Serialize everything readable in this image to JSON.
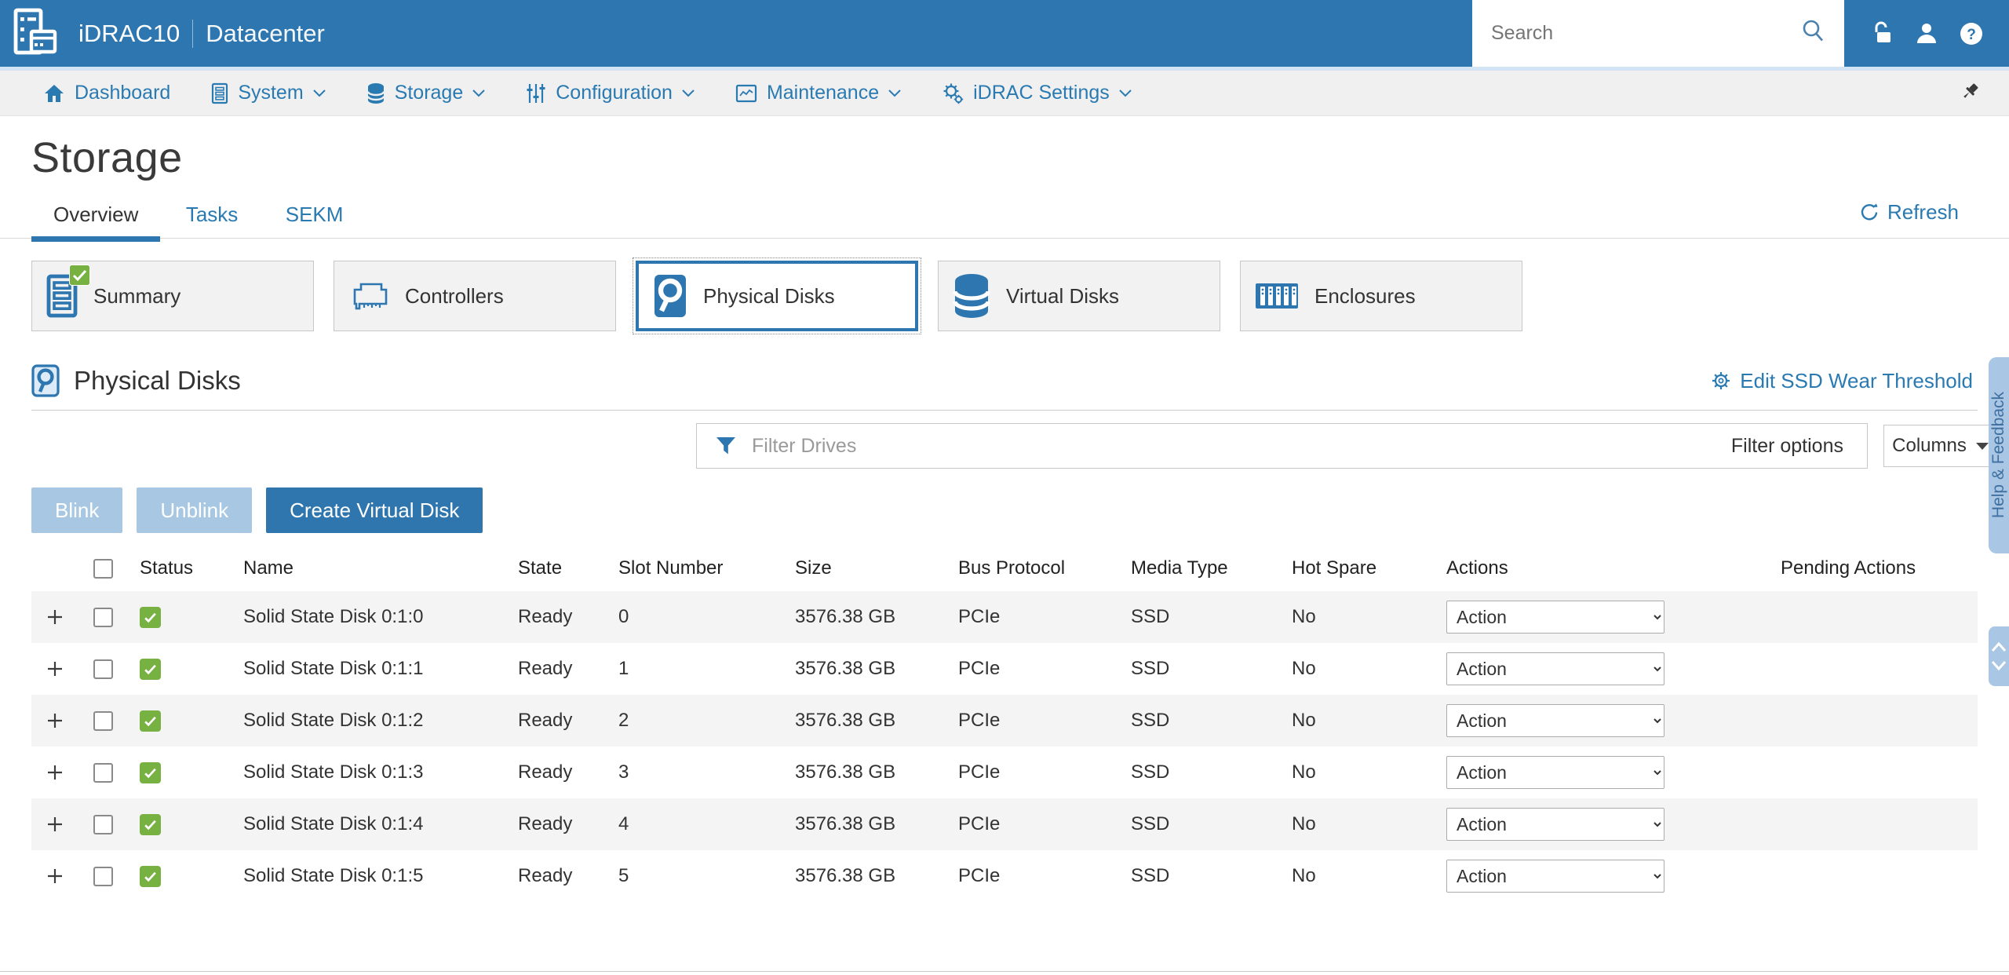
{
  "header": {
    "brand": "iDRAC10",
    "edition": "Datacenter",
    "search_placeholder": "Search"
  },
  "nav": {
    "items": [
      {
        "label": "Dashboard"
      },
      {
        "label": "System"
      },
      {
        "label": "Storage"
      },
      {
        "label": "Configuration"
      },
      {
        "label": "Maintenance"
      },
      {
        "label": "iDRAC Settings"
      }
    ]
  },
  "page": {
    "title": "Storage",
    "tabs": [
      {
        "label": "Overview"
      },
      {
        "label": "Tasks"
      },
      {
        "label": "SEKM"
      }
    ],
    "refresh_label": "Refresh"
  },
  "cards": [
    {
      "label": "Summary"
    },
    {
      "label": "Controllers"
    },
    {
      "label": "Physical Disks"
    },
    {
      "label": "Virtual Disks"
    },
    {
      "label": "Enclosures"
    }
  ],
  "section": {
    "title": "Physical Disks",
    "edit_link": "Edit SSD Wear Threshold"
  },
  "filter": {
    "placeholder": "Filter Drives",
    "options_label": "Filter options",
    "columns_label": "Columns"
  },
  "toolbar": {
    "blink": "Blink",
    "unblink": "Unblink",
    "create_vd": "Create Virtual Disk"
  },
  "table": {
    "columns": [
      "Status",
      "Name",
      "State",
      "Slot Number",
      "Size",
      "Bus Protocol",
      "Media Type",
      "Hot Spare",
      "Actions",
      "Pending Actions"
    ],
    "action_label": "Action",
    "rows": [
      {
        "name": "Solid State Disk 0:1:0",
        "state": "Ready",
        "slot": "0",
        "size": "3576.38 GB",
        "bus": "PCIe",
        "media": "SSD",
        "hot_spare": "No"
      },
      {
        "name": "Solid State Disk 0:1:1",
        "state": "Ready",
        "slot": "1",
        "size": "3576.38 GB",
        "bus": "PCIe",
        "media": "SSD",
        "hot_spare": "No"
      },
      {
        "name": "Solid State Disk 0:1:2",
        "state": "Ready",
        "slot": "2",
        "size": "3576.38 GB",
        "bus": "PCIe",
        "media": "SSD",
        "hot_spare": "No"
      },
      {
        "name": "Solid State Disk 0:1:3",
        "state": "Ready",
        "slot": "3",
        "size": "3576.38 GB",
        "bus": "PCIe",
        "media": "SSD",
        "hot_spare": "No"
      },
      {
        "name": "Solid State Disk 0:1:4",
        "state": "Ready",
        "slot": "4",
        "size": "3576.38 GB",
        "bus": "PCIe",
        "media": "SSD",
        "hot_spare": "No"
      },
      {
        "name": "Solid State Disk 0:1:5",
        "state": "Ready",
        "slot": "5",
        "size": "3576.38 GB",
        "bus": "PCIe",
        "media": "SSD",
        "hot_spare": "No"
      }
    ]
  },
  "side": {
    "help_tab": "Help & Feedback"
  },
  "colors": {
    "accent_blue": "#2d76b0",
    "link_blue": "#2a7ab2",
    "disabled_blue": "#a7c7e2",
    "status_green": "#76b142",
    "nav_bg": "#f0f0f1",
    "stripe": "#f4f4f5"
  }
}
